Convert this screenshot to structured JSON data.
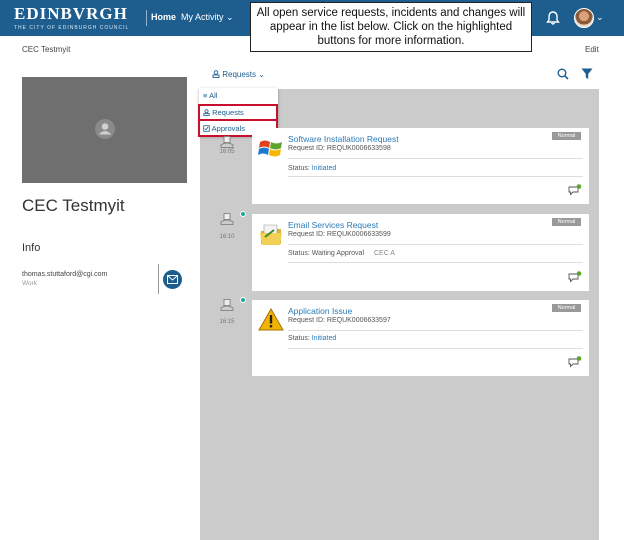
{
  "header": {
    "logo": "EDINBVRGH",
    "logo_sub": "THE CITY OF EDINBURGH COUNCIL",
    "nav_home": "Home",
    "nav_activity": "My Activity ⌄",
    "avatar_chevron": "⌄"
  },
  "tooltip": "All open service requests, incidents and changes will appear in the list below. Click on the highlighted buttons for more information.",
  "breadcrumb": "CEC Testmyit",
  "edit_label": "Edit",
  "profile": {
    "name": "CEC Testmyit",
    "info_heading": "Info",
    "email": "thomas.stuttaford@cgi.com",
    "email_type": "Work"
  },
  "feed": {
    "selector": "Requests ⌄",
    "dropdown": [
      "All",
      "Requests",
      "Approvals"
    ]
  },
  "timeline": [
    {
      "time": "16:05"
    },
    {
      "time": "16:10"
    },
    {
      "time": "16:15"
    }
  ],
  "cards": [
    {
      "title": "Software Installation Request",
      "id": "Request ID: REQUK0006633598",
      "status_label": "Status: ",
      "status_value": "Initiated",
      "status_extra": "",
      "badge": "Normal"
    },
    {
      "title": "Email Services Request",
      "id": "Request ID: REQUK0006633599",
      "status_label": "Status: ",
      "status_value": "Waiting Approval",
      "status_extra": "CEC A",
      "badge": "Normal"
    },
    {
      "title": "Application Issue",
      "id": "Request ID: REQUK0006633597",
      "status_label": "Status: ",
      "status_value": "Initiated",
      "status_extra": "",
      "badge": "Normal"
    }
  ],
  "colors": {
    "brand": "#1d5e8f",
    "accent": "#2a7ab6",
    "highlight": "#c8102e",
    "dot": "#1fa89a"
  }
}
